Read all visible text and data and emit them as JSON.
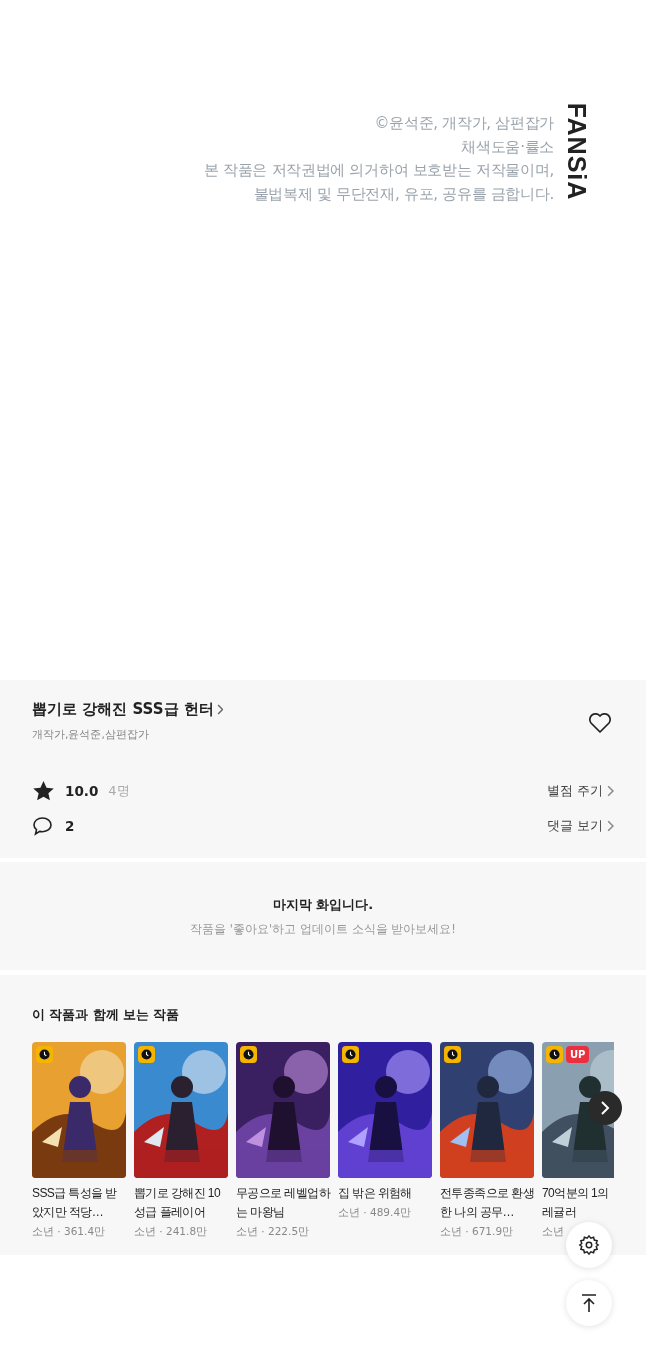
{
  "copyright": {
    "lines": [
      "©윤석준, 개작가, 삼편잡가",
      "채색도움·률소",
      "본 작품은 저작권법에 의거하여 보호받는 저작물이며,",
      "불법복제 및 무단전재, 유포, 공유를 금합니다."
    ],
    "logo": "FANSiA"
  },
  "work": {
    "title": "뽑기로 강해진 SSS급 헌터",
    "authors": "개작가,윤석준,삼편잡가",
    "liked": false,
    "rating": "10.0",
    "raters": "4명",
    "rate_action": "별점 주기",
    "comments": "2",
    "comment_action": "댓글 보기"
  },
  "notice": {
    "title": "마지막 화입니다.",
    "subtitle": "작품을 '좋아요'하고 업데이트 소식을 받아보세요!"
  },
  "recommendations": {
    "heading": "이 작품과 함께 보는 작품",
    "items": [
      {
        "kind": "picture",
        "title": "SSS급 특성을 받았지만 적당…",
        "stats": "소년 · 361.4만",
        "wait_free": true,
        "up": false
      },
      {
        "kind": "picture",
        "title": "뽑기로 강해진 10성급 플레이어",
        "stats": "소년 · 241.8만",
        "wait_free": true,
        "up": false
      },
      {
        "kind": "picture",
        "title": "무공으로 레벨업하는 마왕님",
        "stats": "소년 · 222.5만",
        "wait_free": true,
        "up": false
      },
      {
        "kind": "picture",
        "title": "집 밖은 위험해",
        "stats": "소년 · 489.4만",
        "wait_free": true,
        "up": false
      },
      {
        "kind": "picture",
        "title": "전투종족으로 환생한 나의 공무…",
        "stats": "소년 · 671.9만",
        "wait_free": true,
        "up": false
      },
      {
        "kind": "picture",
        "title": "70억분의 1의 레귤러",
        "stats": "소년",
        "wait_free": true,
        "up": true,
        "up_label": "UP"
      }
    ]
  }
}
